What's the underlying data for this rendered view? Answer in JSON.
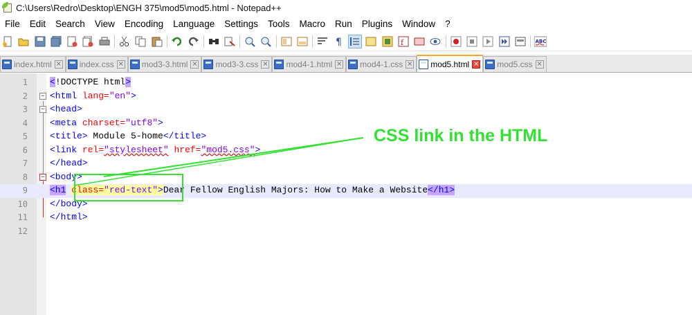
{
  "window": {
    "title": "C:\\Users\\Redro\\Desktop\\ENGH 375\\mod5\\mod5.html - Notepad++"
  },
  "menu": [
    "File",
    "Edit",
    "Search",
    "View",
    "Encoding",
    "Language",
    "Settings",
    "Tools",
    "Macro",
    "Run",
    "Plugins",
    "Window",
    "?"
  ],
  "toolbar": {
    "buttons": [
      "new-file-icon",
      "open-file-icon",
      "save-icon",
      "save-all-icon",
      "close-icon",
      "close-all-icon",
      "print-icon",
      "cut-icon",
      "copy-icon",
      "paste-icon",
      "undo-icon",
      "redo-icon",
      "find-icon",
      "replace-icon",
      "zoom-in-icon",
      "zoom-out-icon",
      "sync-vertical-icon",
      "sync-horizontal-icon",
      "word-wrap-icon",
      "show-all-characters-icon",
      "indent-guide-icon",
      "language-icon",
      "function-list-icon",
      "folder-workspace-icon",
      "document-map-icon",
      "monitoring-icon",
      "record-macro-icon",
      "stop-macro-icon",
      "play-macro-icon",
      "run-macro-multiple-icon",
      "save-macro-icon",
      "spell-check-icon"
    ],
    "spell_check_label": "ABC"
  },
  "tabs": [
    {
      "label": "index.html",
      "active": false
    },
    {
      "label": "index.css",
      "active": false
    },
    {
      "label": "mod3-3.html",
      "active": false
    },
    {
      "label": "mod3-3.css",
      "active": false
    },
    {
      "label": "mod4-1.html",
      "active": false
    },
    {
      "label": "mod4-1.css",
      "active": false
    },
    {
      "label": "mod5.html",
      "active": true
    },
    {
      "label": "mod5.css",
      "active": false
    }
  ],
  "editor": {
    "line_numbers": [
      "1",
      "2",
      "3",
      "4",
      "5",
      "6",
      "7",
      "8",
      "9",
      "10",
      "11",
      "12"
    ],
    "lines": {
      "l1": {
        "open": "<",
        "doctype": "!DOCTYPE html",
        "close": ">"
      },
      "l2": {
        "tag_open": "<html ",
        "attr": "lang=",
        "val": "\"en\"",
        "tag_close": ">"
      },
      "l3": {
        "tag": "<head>"
      },
      "l4": {
        "tag_open": "<meta ",
        "attr": "charset=",
        "val": "\"utf8\"",
        "tag_close": ">"
      },
      "l5": {
        "tag_open": "<title>",
        "text": " Module 5-home",
        "tag_close": "</title>"
      },
      "l6": {
        "tag_open": "<link ",
        "attr1": "rel=",
        "val1": "\"stylesheet\"",
        "space": " ",
        "attr2": "href=",
        "val2": "\"mod5.css\"",
        "tag_close": ">"
      },
      "l7": {
        "tag": "</head>"
      },
      "l8": {
        "tag": "<body>"
      },
      "l9": {
        "tag_open": "<h1",
        "space": " ",
        "attr": "class=",
        "val": "\"red-text\"",
        "gt": ">",
        "text": "Dear Fellow English Majors: How to Make a Website",
        "tag_close": "</h1>"
      },
      "l10": {
        "tag": "</body>"
      },
      "l11": {
        "tag": "</html>"
      }
    }
  },
  "annotation": {
    "label": "CSS link in the HTML",
    "color": "#33e033"
  }
}
